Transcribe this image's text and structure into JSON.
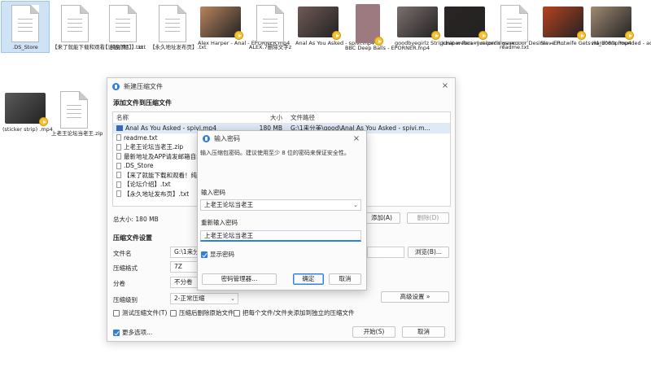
{
  "desktop": {
    "row1": [
      {
        "label": ".DS_Store",
        "kind": "doc",
        "selected": true
      },
      {
        "label": "【来了就能下载和观看！纯免费！】.txt",
        "kind": "doc"
      },
      {
        "label": "【论坛介绍】.txt",
        "kind": "doc"
      },
      {
        "label": "【永久地址发布页】.txt",
        "kind": "doc"
      },
      {
        "label": "Alex Harper - Anal - EPORNER.mp4",
        "kind": "video",
        "color": "#b8845e"
      },
      {
        "label": "ALEX.7删除文字z",
        "kind": "doc"
      },
      {
        "label": "Anal As You Asked - spivi.mp4",
        "kind": "video",
        "color": "#6f5a56"
      },
      {
        "label": "BBC Deep Balls - EPORNER.mp4",
        "kind": "portrait",
        "color": "#9d7a80"
      },
      {
        "label": "goodbyegirlz Stripchat webcam recordings Ar...",
        "kind": "video",
        "color": "#7d6f6f"
      },
      {
        "label": "Juniper Ren - Juniper s Backdoor Desires - EP...",
        "kind": "video",
        "color": "#2c2424"
      },
      {
        "label": "readme.txt",
        "kind": "doc"
      },
      {
        "label": "Slave Hotwife Gets Hardcore Pounded - adorableno...",
        "kind": "video",
        "color": "#b8421f"
      },
      {
        "label": "vid_1080p.mp4",
        "kind": "video",
        "color": "#a08a74"
      }
    ],
    "row2": [
      {
        "label": "(sticker strip) .mp4",
        "kind": "video",
        "color": "#5a5a5a"
      },
      {
        "label": "上老王论坛当老王.zip",
        "kind": "doc"
      }
    ]
  },
  "main_dialog": {
    "title": "新建压缩文件",
    "close": "×",
    "section_add": "添加文件到压缩文件",
    "list_headers": {
      "name": "名称",
      "size": "大小",
      "path": "文件路径"
    },
    "files": [
      {
        "name": "Anal As You Asked - spivi.mp4",
        "size": "180 MB",
        "path": "G:\\1来分美\\good\\Anal As You Asked - spivi.m...",
        "icon": "video"
      },
      {
        "name": "readme.txt",
        "size": "",
        "path": "",
        "icon": "doc"
      },
      {
        "name": "上老王论坛当老王.zip",
        "size": "",
        "path": "当老王.zip",
        "icon": "doc"
      },
      {
        "name": "最新地址及APP请发邮箱自动获...",
        "size": "",
        "path": "APP请发邮箱自动获...",
        "icon": "doc"
      },
      {
        "name": ".DS_Store",
        "size": "",
        "path": "",
        "icon": "doc"
      },
      {
        "name": "【来了就能下载和观看！纯免费...",
        "size": "",
        "path": "下载和观看！纯免...",
        "icon": "doc"
      },
      {
        "name": "【论坛介绍】.txt",
        "size": "",
        "path": "",
        "icon": "doc"
      },
      {
        "name": "【永久地址发布页】.txt",
        "size": "",
        "path": "发布页】.txt",
        "icon": "doc"
      }
    ],
    "total_size": "总大小: 180 MB",
    "add_button": "添加(A)",
    "delete_button": "删除(D)",
    "section_settings": "压缩文件设置",
    "filename_label": "文件名",
    "filename_value": "G:\\1来分美",
    "browse_button": "浏览(B)...",
    "format_label": "压缩格式",
    "format_value": "7Z",
    "split_label": "分卷",
    "split_value": "不分卷",
    "level_label": "压缩级别",
    "level_value": "2-正常压缩",
    "advanced_button": "高级设置 »",
    "opt_test": "测试压缩文件(T)",
    "opt_delete": "压缩后删除原始文件",
    "opt_separate": "把每个文件/文件夹添加到独立的压缩文件",
    "more_options": "更多选项...",
    "start_button": "开始(S)",
    "cancel_button": "取消"
  },
  "password_dialog": {
    "title": "输入密码",
    "close": "×",
    "description": "输入压缩包密码。建议使用至少 8 位的密码来保证安全性。",
    "password_label": "输入密码",
    "password_value": "上老王论坛当老王",
    "repeat_label": "重新输入密码",
    "repeat_value": "上老王论坛当老王",
    "show_password": "显示密码",
    "manager_button": "密码管理器...",
    "ok_button": "确定",
    "cancel_button": "取消"
  }
}
